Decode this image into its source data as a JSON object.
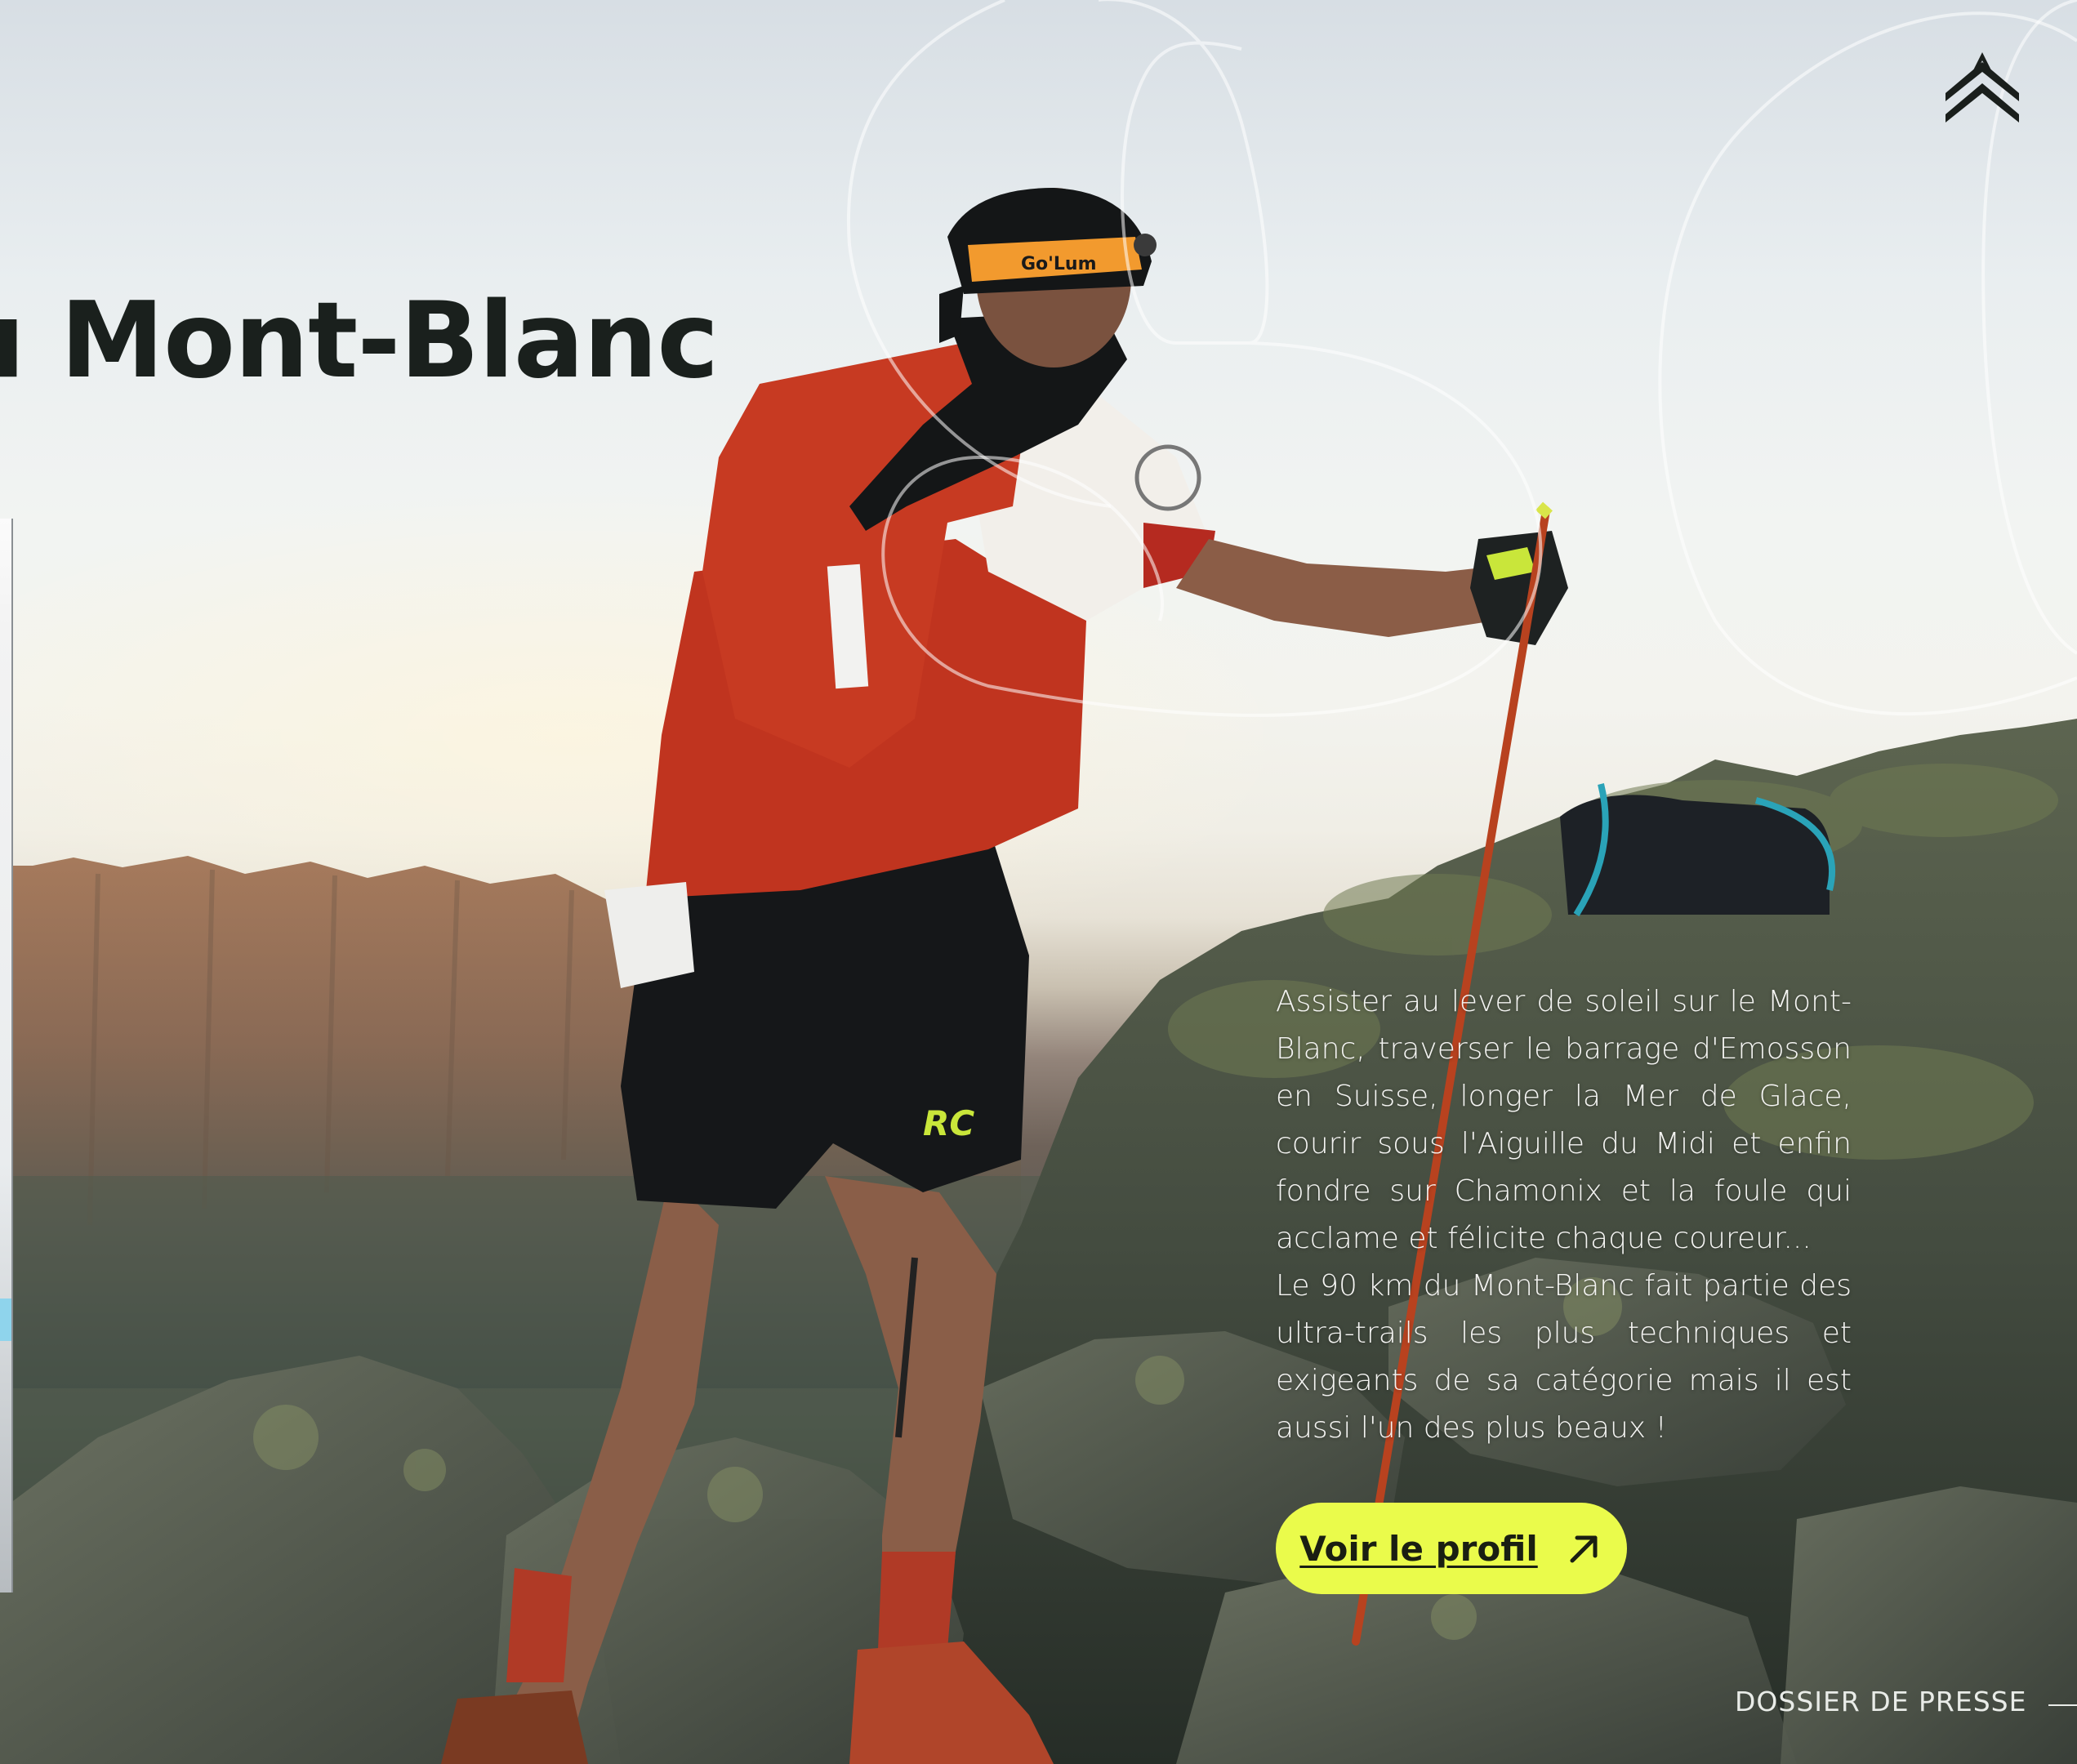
{
  "hero": {
    "headline": "u Mont-Blanc",
    "paragraph_1": "Assister au lever de soleil sur le Mont-Blanc, traverser le barrage d'Emosson en Suisse, longer la Mer de Glace, courir sous l'Aiguille du Midi et enfin fondre sur Chamonix et la foule qui acclame et félicite chaque coureur...",
    "paragraph_2": "Le 90 km du Mont-Blanc fait partie des ultra-trails les plus techniques et exigeants de sa catégorie mais il est aussi l'un des plus beaux !",
    "image_alt": "Trail runner with poles climbing rocky ridge at sunrise"
  },
  "cta": {
    "label": "Voir le profil",
    "icon": "arrow-up-right-icon"
  },
  "footer": {
    "press_label": "DOSSIER DE PRESSE"
  },
  "brand": {
    "logo_icon": "double-chevron-up-icon"
  },
  "colors": {
    "accent": "#eafb4b",
    "headline": "#1a201d",
    "body_text": "#f4f4f2"
  }
}
